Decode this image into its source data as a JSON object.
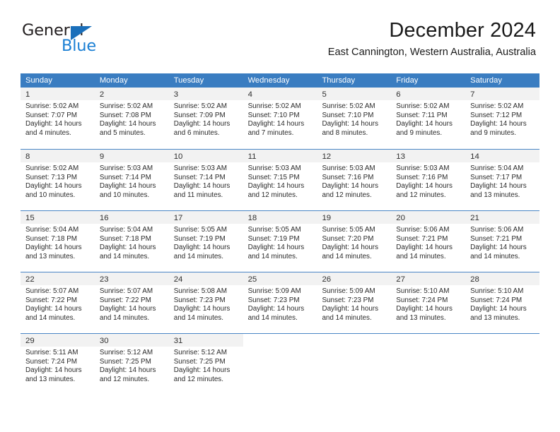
{
  "brand": {
    "name_part1": "General",
    "name_part2": "Blue",
    "triangle_color": "#1a6fba",
    "blue_color": "#1a7fd4"
  },
  "header": {
    "month_title": "December 2024",
    "location": "East Cannington, Western Australia, Australia"
  },
  "theme": {
    "header_blue": "#3a7dc1",
    "row_rule": "#4a86c5",
    "day_band": "#f2f2f2"
  },
  "calendar": {
    "day_headers": [
      "Sunday",
      "Monday",
      "Tuesday",
      "Wednesday",
      "Thursday",
      "Friday",
      "Saturday"
    ],
    "weeks": [
      [
        {
          "day": "1",
          "sunrise": "Sunrise: 5:02 AM",
          "sunset": "Sunset: 7:07 PM",
          "daylight1": "Daylight: 14 hours",
          "daylight2": "and 4 minutes."
        },
        {
          "day": "2",
          "sunrise": "Sunrise: 5:02 AM",
          "sunset": "Sunset: 7:08 PM",
          "daylight1": "Daylight: 14 hours",
          "daylight2": "and 5 minutes."
        },
        {
          "day": "3",
          "sunrise": "Sunrise: 5:02 AM",
          "sunset": "Sunset: 7:09 PM",
          "daylight1": "Daylight: 14 hours",
          "daylight2": "and 6 minutes."
        },
        {
          "day": "4",
          "sunrise": "Sunrise: 5:02 AM",
          "sunset": "Sunset: 7:10 PM",
          "daylight1": "Daylight: 14 hours",
          "daylight2": "and 7 minutes."
        },
        {
          "day": "5",
          "sunrise": "Sunrise: 5:02 AM",
          "sunset": "Sunset: 7:10 PM",
          "daylight1": "Daylight: 14 hours",
          "daylight2": "and 8 minutes."
        },
        {
          "day": "6",
          "sunrise": "Sunrise: 5:02 AM",
          "sunset": "Sunset: 7:11 PM",
          "daylight1": "Daylight: 14 hours",
          "daylight2": "and 9 minutes."
        },
        {
          "day": "7",
          "sunrise": "Sunrise: 5:02 AM",
          "sunset": "Sunset: 7:12 PM",
          "daylight1": "Daylight: 14 hours",
          "daylight2": "and 9 minutes."
        }
      ],
      [
        {
          "day": "8",
          "sunrise": "Sunrise: 5:02 AM",
          "sunset": "Sunset: 7:13 PM",
          "daylight1": "Daylight: 14 hours",
          "daylight2": "and 10 minutes."
        },
        {
          "day": "9",
          "sunrise": "Sunrise: 5:03 AM",
          "sunset": "Sunset: 7:14 PM",
          "daylight1": "Daylight: 14 hours",
          "daylight2": "and 10 minutes."
        },
        {
          "day": "10",
          "sunrise": "Sunrise: 5:03 AM",
          "sunset": "Sunset: 7:14 PM",
          "daylight1": "Daylight: 14 hours",
          "daylight2": "and 11 minutes."
        },
        {
          "day": "11",
          "sunrise": "Sunrise: 5:03 AM",
          "sunset": "Sunset: 7:15 PM",
          "daylight1": "Daylight: 14 hours",
          "daylight2": "and 12 minutes."
        },
        {
          "day": "12",
          "sunrise": "Sunrise: 5:03 AM",
          "sunset": "Sunset: 7:16 PM",
          "daylight1": "Daylight: 14 hours",
          "daylight2": "and 12 minutes."
        },
        {
          "day": "13",
          "sunrise": "Sunrise: 5:03 AM",
          "sunset": "Sunset: 7:16 PM",
          "daylight1": "Daylight: 14 hours",
          "daylight2": "and 12 minutes."
        },
        {
          "day": "14",
          "sunrise": "Sunrise: 5:04 AM",
          "sunset": "Sunset: 7:17 PM",
          "daylight1": "Daylight: 14 hours",
          "daylight2": "and 13 minutes."
        }
      ],
      [
        {
          "day": "15",
          "sunrise": "Sunrise: 5:04 AM",
          "sunset": "Sunset: 7:18 PM",
          "daylight1": "Daylight: 14 hours",
          "daylight2": "and 13 minutes."
        },
        {
          "day": "16",
          "sunrise": "Sunrise: 5:04 AM",
          "sunset": "Sunset: 7:18 PM",
          "daylight1": "Daylight: 14 hours",
          "daylight2": "and 14 minutes."
        },
        {
          "day": "17",
          "sunrise": "Sunrise: 5:05 AM",
          "sunset": "Sunset: 7:19 PM",
          "daylight1": "Daylight: 14 hours",
          "daylight2": "and 14 minutes."
        },
        {
          "day": "18",
          "sunrise": "Sunrise: 5:05 AM",
          "sunset": "Sunset: 7:19 PM",
          "daylight1": "Daylight: 14 hours",
          "daylight2": "and 14 minutes."
        },
        {
          "day": "19",
          "sunrise": "Sunrise: 5:05 AM",
          "sunset": "Sunset: 7:20 PM",
          "daylight1": "Daylight: 14 hours",
          "daylight2": "and 14 minutes."
        },
        {
          "day": "20",
          "sunrise": "Sunrise: 5:06 AM",
          "sunset": "Sunset: 7:21 PM",
          "daylight1": "Daylight: 14 hours",
          "daylight2": "and 14 minutes."
        },
        {
          "day": "21",
          "sunrise": "Sunrise: 5:06 AM",
          "sunset": "Sunset: 7:21 PM",
          "daylight1": "Daylight: 14 hours",
          "daylight2": "and 14 minutes."
        }
      ],
      [
        {
          "day": "22",
          "sunrise": "Sunrise: 5:07 AM",
          "sunset": "Sunset: 7:22 PM",
          "daylight1": "Daylight: 14 hours",
          "daylight2": "and 14 minutes."
        },
        {
          "day": "23",
          "sunrise": "Sunrise: 5:07 AM",
          "sunset": "Sunset: 7:22 PM",
          "daylight1": "Daylight: 14 hours",
          "daylight2": "and 14 minutes."
        },
        {
          "day": "24",
          "sunrise": "Sunrise: 5:08 AM",
          "sunset": "Sunset: 7:23 PM",
          "daylight1": "Daylight: 14 hours",
          "daylight2": "and 14 minutes."
        },
        {
          "day": "25",
          "sunrise": "Sunrise: 5:09 AM",
          "sunset": "Sunset: 7:23 PM",
          "daylight1": "Daylight: 14 hours",
          "daylight2": "and 14 minutes."
        },
        {
          "day": "26",
          "sunrise": "Sunrise: 5:09 AM",
          "sunset": "Sunset: 7:23 PM",
          "daylight1": "Daylight: 14 hours",
          "daylight2": "and 14 minutes."
        },
        {
          "day": "27",
          "sunrise": "Sunrise: 5:10 AM",
          "sunset": "Sunset: 7:24 PM",
          "daylight1": "Daylight: 14 hours",
          "daylight2": "and 13 minutes."
        },
        {
          "day": "28",
          "sunrise": "Sunrise: 5:10 AM",
          "sunset": "Sunset: 7:24 PM",
          "daylight1": "Daylight: 14 hours",
          "daylight2": "and 13 minutes."
        }
      ],
      [
        {
          "day": "29",
          "sunrise": "Sunrise: 5:11 AM",
          "sunset": "Sunset: 7:24 PM",
          "daylight1": "Daylight: 14 hours",
          "daylight2": "and 13 minutes."
        },
        {
          "day": "30",
          "sunrise": "Sunrise: 5:12 AM",
          "sunset": "Sunset: 7:25 PM",
          "daylight1": "Daylight: 14 hours",
          "daylight2": "and 12 minutes."
        },
        {
          "day": "31",
          "sunrise": "Sunrise: 5:12 AM",
          "sunset": "Sunset: 7:25 PM",
          "daylight1": "Daylight: 14 hours",
          "daylight2": "and 12 minutes."
        },
        {
          "day": "",
          "sunrise": "",
          "sunset": "",
          "daylight1": "",
          "daylight2": ""
        },
        {
          "day": "",
          "sunrise": "",
          "sunset": "",
          "daylight1": "",
          "daylight2": ""
        },
        {
          "day": "",
          "sunrise": "",
          "sunset": "",
          "daylight1": "",
          "daylight2": ""
        },
        {
          "day": "",
          "sunrise": "",
          "sunset": "",
          "daylight1": "",
          "daylight2": ""
        }
      ]
    ]
  }
}
